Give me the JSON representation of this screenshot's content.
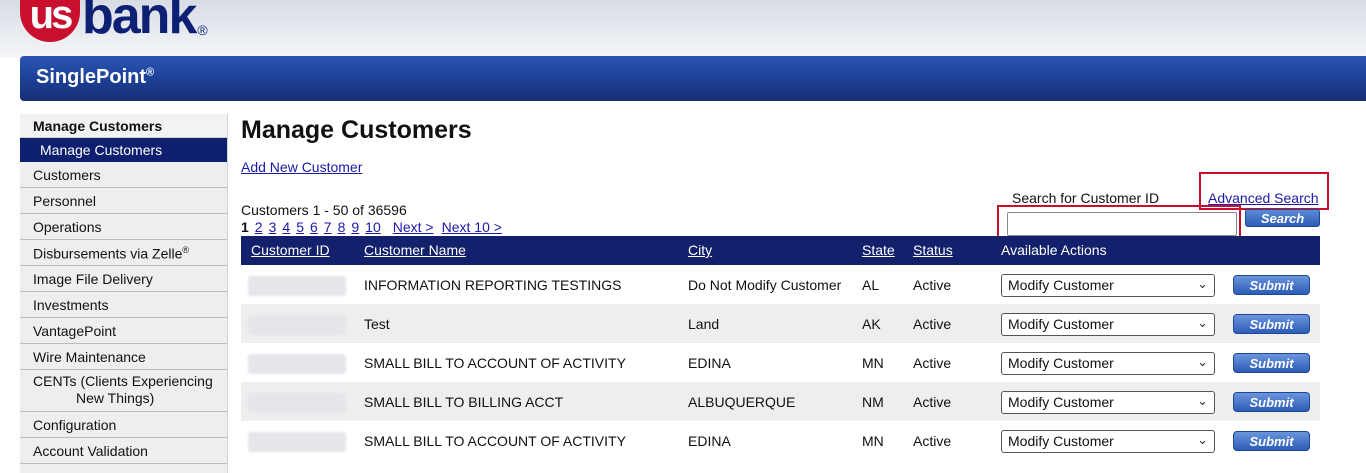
{
  "brand": {
    "logo_shield": "us",
    "logo_text": "bank",
    "logo_mark": "®",
    "product": "SinglePoint",
    "product_mark": "®"
  },
  "sidebar": {
    "header": "Manage Customers",
    "items": [
      {
        "label": "Manage Customers",
        "active": true
      },
      {
        "label": "Customers"
      },
      {
        "label": "Personnel"
      },
      {
        "label": "Operations"
      },
      {
        "label": "Disbursements via Zelle",
        "sup": "®"
      },
      {
        "label": "Image File Delivery"
      },
      {
        "label": "Investments"
      },
      {
        "label": "VantagePoint"
      },
      {
        "label": "Wire Maintenance"
      },
      {
        "label_line1": "CENTs (Clients Experiencing",
        "label_line2": "New Things)"
      },
      {
        "label": "Configuration"
      },
      {
        "label": "Account Validation"
      }
    ]
  },
  "main": {
    "title": "Manage Customers",
    "add_link": "Add New Customer",
    "count_text": "Customers 1 - 50 of 36596",
    "pager": {
      "current": "1",
      "pages": [
        "2",
        "3",
        "4",
        "5",
        "6",
        "7",
        "8",
        "9",
        "10"
      ],
      "next": "Next >",
      "next10": "Next 10 >"
    },
    "search": {
      "label": "Search for Customer ID",
      "placeholder": "",
      "button": "Search",
      "advanced": "Advanced Search"
    }
  },
  "table": {
    "columns": [
      "Customer ID",
      "Customer Name",
      "City",
      "State",
      "Status",
      "Available Actions"
    ],
    "rows": [
      {
        "name": "INFORMATION REPORTING TESTINGS",
        "city": "Do Not Modify Customer",
        "state": "AL",
        "status": "Active",
        "action": "Modify Customer",
        "submit": "Submit"
      },
      {
        "name": "Test",
        "city": "Land",
        "state": "AK",
        "status": "Active",
        "action": "Modify Customer",
        "submit": "Submit"
      },
      {
        "name": "SMALL BILL TO ACCOUNT OF ACTIVITY",
        "city": "EDINA",
        "state": "MN",
        "status": "Active",
        "action": "Modify Customer",
        "submit": "Submit"
      },
      {
        "name": "SMALL BILL TO BILLING ACCT",
        "city": "ALBUQUERQUE",
        "state": "NM",
        "status": "Active",
        "action": "Modify Customer",
        "submit": "Submit"
      },
      {
        "name": "SMALL BILL TO ACCOUNT OF ACTIVITY",
        "city": "EDINA",
        "state": "MN",
        "status": "Active",
        "action": "Modify Customer",
        "submit": "Submit"
      }
    ]
  },
  "colors": {
    "navy": "#13206b",
    "brand_red": "#c8102e",
    "link": "#1a1aa6"
  }
}
